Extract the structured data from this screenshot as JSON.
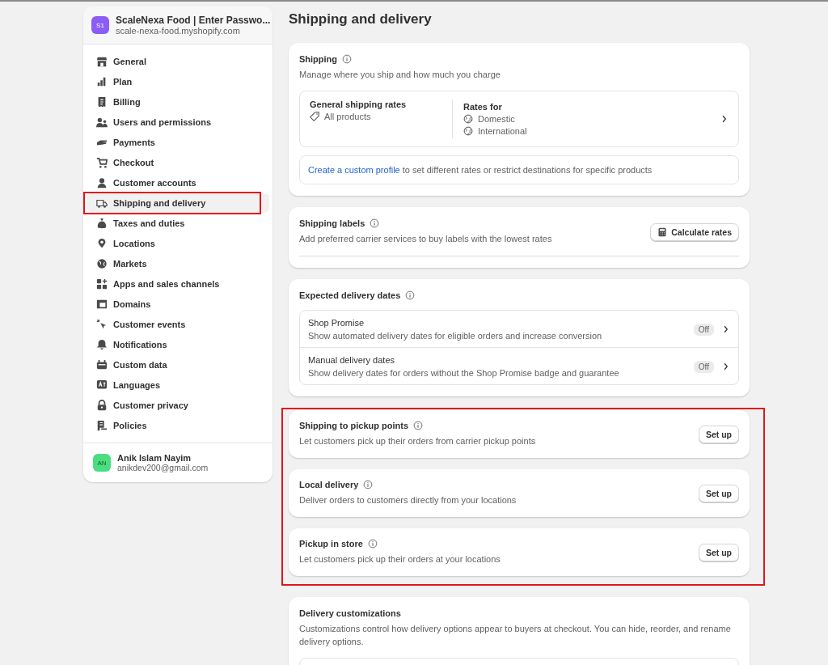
{
  "sidebar": {
    "store": {
      "avatar": "S1",
      "name": "ScaleNexa Food | Enter Passwo...",
      "domain": "scale-nexa-food.myshopify.com"
    },
    "items": [
      {
        "label": "General",
        "selected": false,
        "annotated": false
      },
      {
        "label": "Plan",
        "selected": false,
        "annotated": false
      },
      {
        "label": "Billing",
        "selected": false,
        "annotated": false
      },
      {
        "label": "Users and permissions",
        "selected": false,
        "annotated": false
      },
      {
        "label": "Payments",
        "selected": false,
        "annotated": false
      },
      {
        "label": "Checkout",
        "selected": false,
        "annotated": false
      },
      {
        "label": "Customer accounts",
        "selected": false,
        "annotated": false
      },
      {
        "label": "Shipping and delivery",
        "selected": true,
        "annotated": true
      },
      {
        "label": "Taxes and duties",
        "selected": false,
        "annotated": false
      },
      {
        "label": "Locations",
        "selected": false,
        "annotated": false
      },
      {
        "label": "Markets",
        "selected": false,
        "annotated": false
      },
      {
        "label": "Apps and sales channels",
        "selected": false,
        "annotated": false
      },
      {
        "label": "Domains",
        "selected": false,
        "annotated": false
      },
      {
        "label": "Customer events",
        "selected": false,
        "annotated": false
      },
      {
        "label": "Notifications",
        "selected": false,
        "annotated": false
      },
      {
        "label": "Custom data",
        "selected": false,
        "annotated": false
      },
      {
        "label": "Languages",
        "selected": false,
        "annotated": false
      },
      {
        "label": "Customer privacy",
        "selected": false,
        "annotated": false
      },
      {
        "label": "Policies",
        "selected": false,
        "annotated": false
      }
    ],
    "user": {
      "avatar": "AN",
      "name": "Anik Islam Nayim",
      "email": "anikdev200@gmail.com"
    }
  },
  "page_title": "Shipping and delivery",
  "sections": [
    {
      "kind": "shipping",
      "title": "Shipping",
      "description": "Manage where you ship and how much you charge",
      "profile": {
        "title": "General shipping rates",
        "products": "All products",
        "rates_title": "Rates for",
        "rates": [
          "Domestic",
          "International"
        ]
      },
      "note_link": "Create a custom profile",
      "note_text": " to set different rates or restrict destinations for specific products"
    },
    {
      "kind": "labels",
      "title": "Shipping labels",
      "description": "Add preferred carrier services to buy labels with the lowest rates",
      "button": "Calculate rates"
    },
    {
      "kind": "dates",
      "title": "Expected delivery dates",
      "rows": [
        {
          "title": "Shop Promise",
          "description": "Show automated delivery dates for eligible orders and increase conversion",
          "status": "Off"
        },
        {
          "title": "Manual delivery dates",
          "description": "Show delivery dates for orders without the Shop Promise badge and guarantee",
          "status": "Off"
        }
      ]
    },
    {
      "kind": "group",
      "annotated": true,
      "cards": [
        {
          "title": "Shipping to pickup points",
          "description": "Let customers pick up their orders from carrier pickup points",
          "button": "Set up"
        },
        {
          "title": "Local delivery",
          "description": "Deliver orders to customers directly from your locations",
          "button": "Set up"
        },
        {
          "title": "Pickup in store",
          "description": "Let customers pick up their orders at your locations",
          "button": "Set up"
        }
      ]
    },
    {
      "kind": "customizations",
      "title": "Delivery customizations",
      "description": "Customizations control how delivery options appear to buyers at checkout. You can hide, reorder, and rename delivery options."
    }
  ]
}
